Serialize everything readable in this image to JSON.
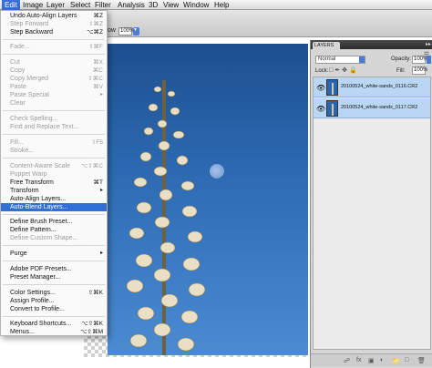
{
  "menubar": {
    "items": [
      "Edit",
      "Image",
      "Layer",
      "Select",
      "Filter",
      "Analysis",
      "3D",
      "View",
      "Window",
      "Help"
    ]
  },
  "options_bar": {
    "zoom_label": "ow",
    "zoom_value": "100%"
  },
  "edit_menu": {
    "items": [
      {
        "label": "Undo Auto-Align Layers",
        "shortcut": "⌘Z",
        "enabled": true
      },
      {
        "label": "Step Forward",
        "shortcut": "⇧⌘Z",
        "enabled": false
      },
      {
        "label": "Step Backward",
        "shortcut": "⌥⌘Z",
        "enabled": true
      },
      {
        "label": "Fade...",
        "shortcut": "⇧⌘F",
        "enabled": false
      },
      {
        "label": "Cut",
        "shortcut": "⌘X",
        "enabled": false
      },
      {
        "label": "Copy",
        "shortcut": "⌘C",
        "enabled": false
      },
      {
        "label": "Copy Merged",
        "shortcut": "⇧⌘C",
        "enabled": false
      },
      {
        "label": "Paste",
        "shortcut": "⌘V",
        "enabled": false
      },
      {
        "label": "Paste Special",
        "shortcut": "▸",
        "enabled": false
      },
      {
        "label": "Clear",
        "shortcut": "",
        "enabled": false
      },
      {
        "label": "Check Spelling...",
        "shortcut": "",
        "enabled": false
      },
      {
        "label": "Find and Replace Text...",
        "shortcut": "",
        "enabled": false
      },
      {
        "label": "Fill...",
        "shortcut": "⇧F5",
        "enabled": false
      },
      {
        "label": "Stroke...",
        "shortcut": "",
        "enabled": false
      },
      {
        "label": "Content-Aware Scale",
        "shortcut": "⌥⇧⌘C",
        "enabled": false
      },
      {
        "label": "Puppet Warp",
        "shortcut": "",
        "enabled": false
      },
      {
        "label": "Free Transform",
        "shortcut": "⌘T",
        "enabled": true
      },
      {
        "label": "Transform",
        "shortcut": "▸",
        "enabled": true
      },
      {
        "label": "Auto-Align Layers...",
        "shortcut": "",
        "enabled": true
      },
      {
        "label": "Auto-Blend Layers...",
        "shortcut": "",
        "enabled": true,
        "highlighted": true
      },
      {
        "label": "Define Brush Preset...",
        "shortcut": "",
        "enabled": true
      },
      {
        "label": "Define Pattern...",
        "shortcut": "",
        "enabled": true
      },
      {
        "label": "Define Custom Shape...",
        "shortcut": "",
        "enabled": false
      },
      {
        "label": "Purge",
        "shortcut": "▸",
        "enabled": true
      },
      {
        "label": "Adobe PDF Presets...",
        "shortcut": "",
        "enabled": true
      },
      {
        "label": "Preset Manager...",
        "shortcut": "",
        "enabled": true
      },
      {
        "label": "Color Settings...",
        "shortcut": "⇧⌘K",
        "enabled": true
      },
      {
        "label": "Assign Profile...",
        "shortcut": "",
        "enabled": true
      },
      {
        "label": "Convert to Profile...",
        "shortcut": "",
        "enabled": true
      },
      {
        "label": "Keyboard Shortcuts...",
        "shortcut": "⌥⇧⌘K",
        "enabled": true
      },
      {
        "label": "Menus...",
        "shortcut": "⌥⇧⌘M",
        "enabled": true
      }
    ]
  },
  "layers_panel": {
    "tab": "LAYERS",
    "menu_icon": "panel-menu-icon",
    "blend_mode": "Normal",
    "opacity_label": "Opacity:",
    "opacity_value": "100%",
    "lock_label": "Lock:",
    "fill_label": "Fill:",
    "fill_value": "100%",
    "layers": [
      {
        "name": "20100524_white-sands_0116.CR2",
        "visible": true,
        "selected": true
      },
      {
        "name": "20100524_white-sands_0117.CR2",
        "visible": true,
        "selected": true
      }
    ],
    "footer_icons": [
      "link-icon",
      "fx-icon",
      "mask-icon",
      "adjustment-icon",
      "folder-icon",
      "new-layer-icon",
      "trash-icon"
    ]
  },
  "colors": {
    "menu_highlight": "#2f6fd6",
    "layer_selected": "#b9d6f3",
    "sky": "#2a66ad"
  }
}
